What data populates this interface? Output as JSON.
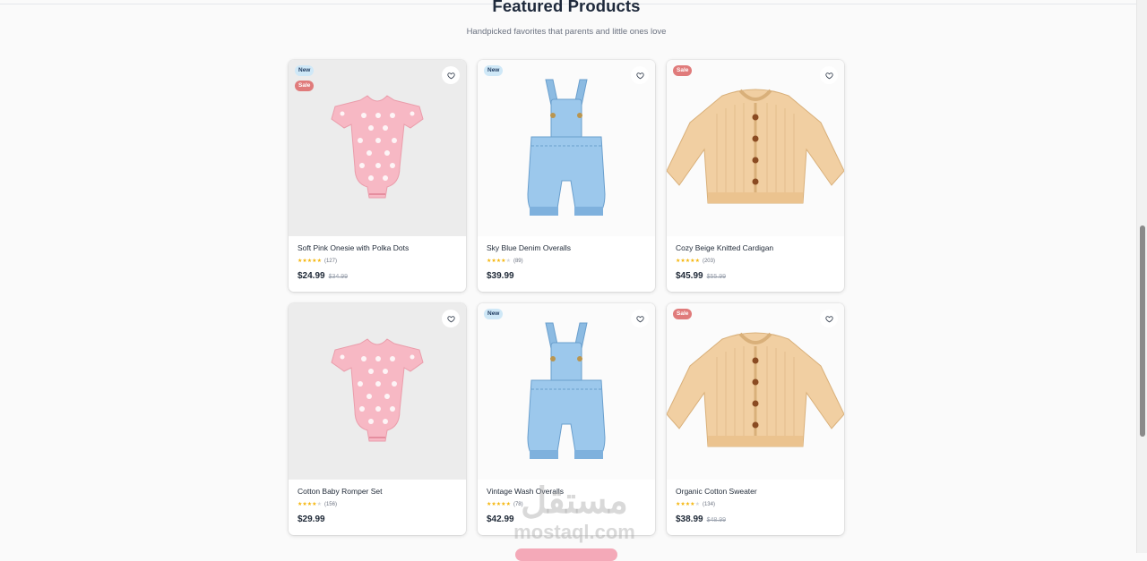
{
  "section": {
    "title": "Featured Products",
    "subtitle": "Handpicked favorites that parents and little ones love"
  },
  "colors": {
    "star": "#f5b50a",
    "sale_badge": "#e07b7b",
    "new_badge": "#cfe8f7",
    "button": "#f4a9b8"
  },
  "products": [
    {
      "name": "Soft Pink Onesie with Polka Dots",
      "rating": 5,
      "reviews": "(127)",
      "price": "$24.99",
      "old_price": "$34.99",
      "badges": [
        "New",
        "Sale"
      ],
      "image": "pink-onesie",
      "stars": "★★★★★"
    },
    {
      "name": "Sky Blue Denim Overalls",
      "rating": 4,
      "reviews": "(89)",
      "price": "$39.99",
      "old_price": "",
      "badges": [
        "New"
      ],
      "image": "denim-overalls",
      "stars": "★★★★☆"
    },
    {
      "name": "Cozy Beige Knitted Cardigan",
      "rating": 5,
      "reviews": "(203)",
      "price": "$45.99",
      "old_price": "$55.99",
      "badges": [
        "Sale"
      ],
      "image": "beige-cardigan",
      "stars": "★★★★★"
    },
    {
      "name": "Cotton Baby Romper Set",
      "rating": 4,
      "reviews": "(156)",
      "price": "$29.99",
      "old_price": "",
      "badges": [],
      "image": "pink-onesie",
      "stars": "★★★★☆"
    },
    {
      "name": "Vintage Wash Overalls",
      "rating": 5,
      "reviews": "(78)",
      "price": "$42.99",
      "old_price": "",
      "badges": [
        "New"
      ],
      "image": "denim-overalls",
      "stars": "★★★★★"
    },
    {
      "name": "Organic Cotton Sweater",
      "rating": 4,
      "reviews": "(134)",
      "price": "$38.99",
      "old_price": "$48.99",
      "badges": [
        "Sale"
      ],
      "image": "beige-cardigan",
      "stars": "★★★★☆"
    }
  ],
  "watermark": {
    "arabic": "مستقل",
    "latin": "mostaql.com"
  }
}
